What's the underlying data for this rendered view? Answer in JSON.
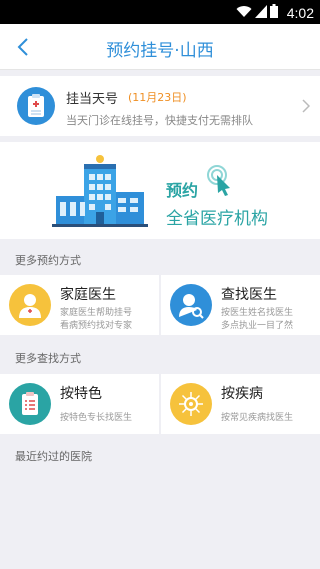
{
  "status_bar": {
    "time": "4:02"
  },
  "nav": {
    "title": "预约挂号·山西"
  },
  "today": {
    "title": "挂当天号",
    "date": "(11月23日)",
    "subtitle": "当天门诊在线挂号，快捷支付无需排队"
  },
  "banner": {
    "title": "预约",
    "subtitle": "全省医疗机构"
  },
  "sections": {
    "more_booking": "更多预约方式",
    "more_search": "更多查找方式",
    "recent": "最近约过的医院"
  },
  "booking_methods": [
    {
      "title": "家庭医生",
      "line1": "家庭医生帮助挂号",
      "line2": "看病预约找对专家"
    },
    {
      "title": "查找医生",
      "line1": "按医生姓名找医生",
      "line2": "多点执业一目了然"
    }
  ],
  "search_methods": [
    {
      "title": "按特色",
      "line1": "按特色专长找医生"
    },
    {
      "title": "按疾病",
      "line1": "按常见疾病找医生"
    }
  ],
  "colors": {
    "accent": "#2f8fd9",
    "teal": "#2aa4a4",
    "orange": "#ef8f24",
    "yellow": "#f6c23c"
  }
}
